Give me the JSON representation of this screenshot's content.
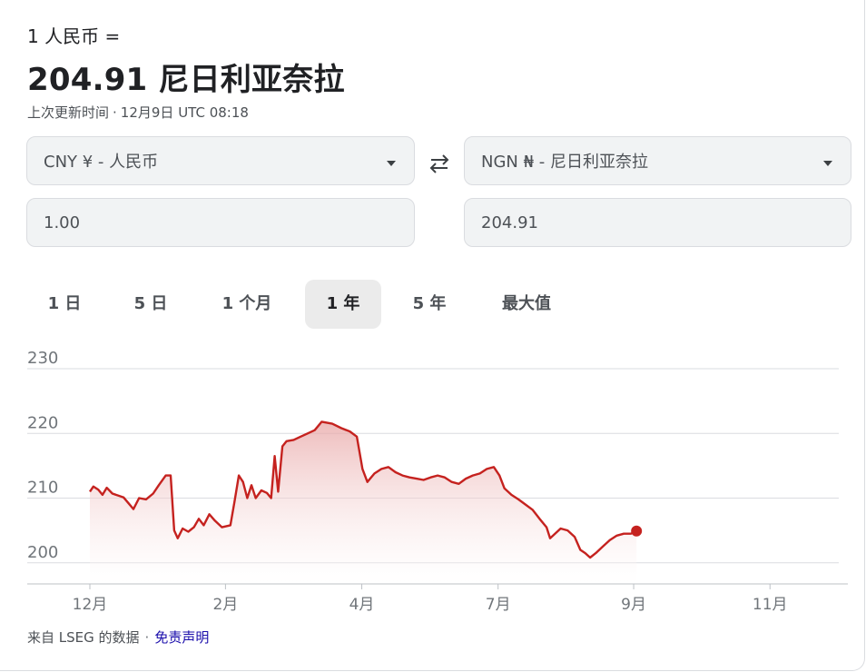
{
  "header": {
    "equation": "1 人民币 =",
    "result": "204.91 尼日利亚奈拉",
    "updated_label": "上次更新时间",
    "updated_time": "12月9日 UTC 08:18"
  },
  "converter": {
    "from_currency": "CNY ¥ - 人民币",
    "to_currency": "NGN ₦ - 尼日利亚奈拉",
    "from_amount": "1.00",
    "to_amount": "204.91"
  },
  "tabs": [
    {
      "label": "1 日",
      "active": false
    },
    {
      "label": "5 日",
      "active": false
    },
    {
      "label": "1 个月",
      "active": false
    },
    {
      "label": "1 年",
      "active": true
    },
    {
      "label": "5 年",
      "active": false
    },
    {
      "label": "最大值",
      "active": false
    }
  ],
  "colors": {
    "line": "#c5221f",
    "fill_top": "#e8a5a5",
    "grid": "#dadce0",
    "link": "#1a0dab"
  },
  "chart_data": {
    "type": "area",
    "x_labels": [
      "12月",
      "2月",
      "4月",
      "7月",
      "9月",
      "11月"
    ],
    "y_ticks": [
      200,
      210,
      220,
      230
    ],
    "ylim": [
      198,
      230
    ],
    "grid": true,
    "x_domain": [
      0,
      1
    ],
    "x_label_positions": [
      0.0,
      0.193,
      0.387,
      0.581,
      0.774,
      0.968
    ],
    "series": [
      {
        "points": [
          [
            0.0,
            211.0
          ],
          [
            0.005,
            211.8
          ],
          [
            0.012,
            211.3
          ],
          [
            0.018,
            210.5
          ],
          [
            0.024,
            211.6
          ],
          [
            0.032,
            210.7
          ],
          [
            0.04,
            210.4
          ],
          [
            0.048,
            210.1
          ],
          [
            0.055,
            209.2
          ],
          [
            0.062,
            208.3
          ],
          [
            0.07,
            210.0
          ],
          [
            0.08,
            209.8
          ],
          [
            0.09,
            210.7
          ],
          [
            0.098,
            212.0
          ],
          [
            0.108,
            213.5
          ],
          [
            0.115,
            213.5
          ],
          [
            0.12,
            205.0
          ],
          [
            0.125,
            203.8
          ],
          [
            0.132,
            205.3
          ],
          [
            0.14,
            204.8
          ],
          [
            0.148,
            205.5
          ],
          [
            0.155,
            206.8
          ],
          [
            0.162,
            205.8
          ],
          [
            0.17,
            207.5
          ],
          [
            0.178,
            206.5
          ],
          [
            0.188,
            205.5
          ],
          [
            0.2,
            205.8
          ],
          [
            0.206,
            209.5
          ],
          [
            0.212,
            213.5
          ],
          [
            0.218,
            212.5
          ],
          [
            0.224,
            210.0
          ],
          [
            0.23,
            212.0
          ],
          [
            0.236,
            210.0
          ],
          [
            0.244,
            211.2
          ],
          [
            0.252,
            210.8
          ],
          [
            0.258,
            210.0
          ],
          [
            0.263,
            216.5
          ],
          [
            0.268,
            211.0
          ],
          [
            0.274,
            218.0
          ],
          [
            0.28,
            218.8
          ],
          [
            0.29,
            219.0
          ],
          [
            0.3,
            219.5
          ],
          [
            0.31,
            220.0
          ],
          [
            0.32,
            220.5
          ],
          [
            0.33,
            221.8
          ],
          [
            0.345,
            221.5
          ],
          [
            0.358,
            220.8
          ],
          [
            0.37,
            220.3
          ],
          [
            0.38,
            219.5
          ],
          [
            0.388,
            214.5
          ],
          [
            0.395,
            212.5
          ],
          [
            0.405,
            213.8
          ],
          [
            0.415,
            214.5
          ],
          [
            0.425,
            214.8
          ],
          [
            0.435,
            214.0
          ],
          [
            0.445,
            213.5
          ],
          [
            0.455,
            213.2
          ],
          [
            0.465,
            213.0
          ],
          [
            0.475,
            212.8
          ],
          [
            0.485,
            213.2
          ],
          [
            0.495,
            213.5
          ],
          [
            0.505,
            213.2
          ],
          [
            0.515,
            212.5
          ],
          [
            0.525,
            212.2
          ],
          [
            0.535,
            213.0
          ],
          [
            0.545,
            213.5
          ],
          [
            0.555,
            213.8
          ],
          [
            0.565,
            214.5
          ],
          [
            0.575,
            214.8
          ],
          [
            0.583,
            213.5
          ],
          [
            0.59,
            211.5
          ],
          [
            0.6,
            210.5
          ],
          [
            0.61,
            209.8
          ],
          [
            0.62,
            209.0
          ],
          [
            0.63,
            208.2
          ],
          [
            0.64,
            206.8
          ],
          [
            0.65,
            205.5
          ],
          [
            0.655,
            203.8
          ],
          [
            0.662,
            204.5
          ],
          [
            0.67,
            205.3
          ],
          [
            0.68,
            205.0
          ],
          [
            0.69,
            204.0
          ],
          [
            0.698,
            202.0
          ],
          [
            0.705,
            201.5
          ],
          [
            0.712,
            200.8
          ],
          [
            0.72,
            201.5
          ],
          [
            0.73,
            202.5
          ],
          [
            0.74,
            203.5
          ],
          [
            0.75,
            204.2
          ],
          [
            0.76,
            204.5
          ],
          [
            0.77,
            204.5
          ],
          [
            0.778,
            204.91
          ]
        ]
      }
    ]
  },
  "footer": {
    "source": "来自 LSEG 的数据",
    "disclaimer": "免责声明"
  }
}
